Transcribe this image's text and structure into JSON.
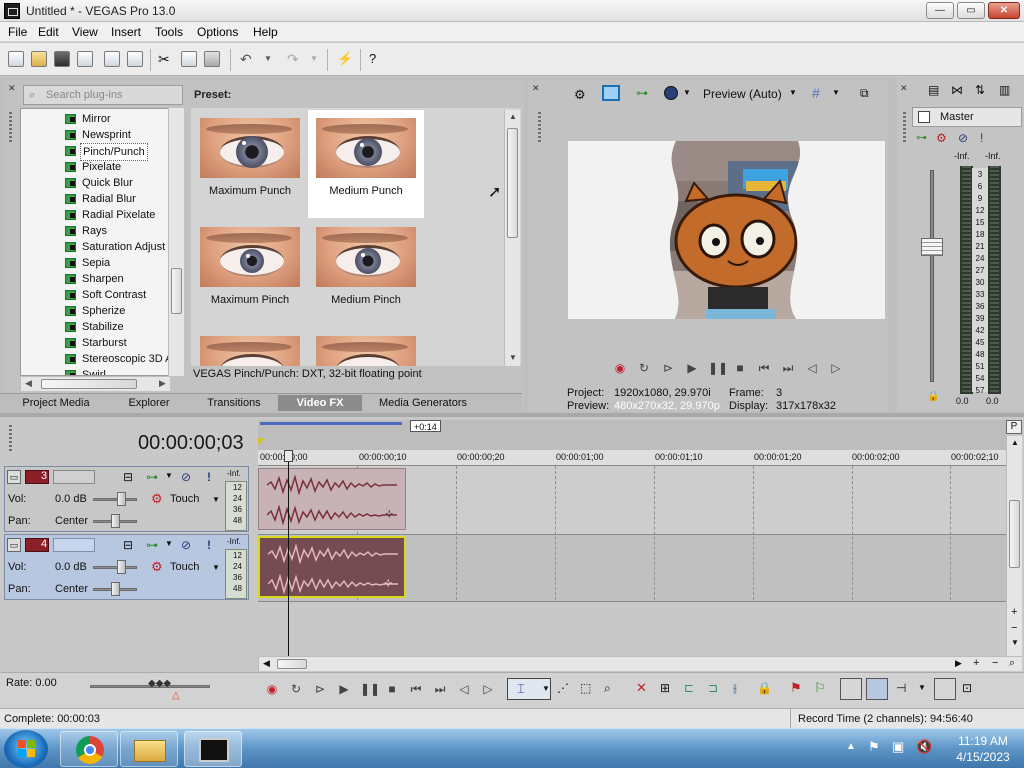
{
  "window": {
    "title": "Untitled * - VEGAS Pro 13.0",
    "controls": {
      "minimize": "—",
      "maximize": "▭",
      "close": "✕"
    }
  },
  "menu": [
    "File",
    "Edit",
    "View",
    "Insert",
    "Tools",
    "Options",
    "Help"
  ],
  "plugins": {
    "search_placeholder": "Search plug-ins",
    "items": [
      "Mirror",
      "Newsprint",
      "Pinch/Punch",
      "Pixelate",
      "Quick Blur",
      "Radial Blur",
      "Radial Pixelate",
      "Rays",
      "Saturation Adjust",
      "Sepia",
      "Sharpen",
      "Soft Contrast",
      "Spherize",
      "Stabilize",
      "Starburst",
      "Stereoscopic 3D A",
      "Swirl"
    ],
    "selected": "Pinch/Punch",
    "icon": "plugin-chip-icon"
  },
  "presets": {
    "label": "Preset:",
    "items": [
      "Maximum Punch",
      "Medium Punch",
      "Maximum Pinch",
      "Medium Pinch",
      "",
      ""
    ],
    "selected": "Medium Punch",
    "description": "VEGAS Pinch/Punch: DXT, 32-bit floating point"
  },
  "tabs": [
    "Project Media",
    "Explorer",
    "Transitions",
    "Video FX",
    "Media Generators"
  ],
  "active_tab": "Video FX",
  "preview": {
    "mode": "Preview (Auto)",
    "project_label": "Project:",
    "project_value": "1920x1080, 29.970i",
    "preview_label": "Preview:",
    "preview_value": "480x270x32, 29.970p",
    "frame_label": "Frame:",
    "frame_value": "3",
    "display_label": "Display:",
    "display_value": "317x178x32"
  },
  "mixer": {
    "title": "Master",
    "peak_left": "-Inf.",
    "peak_right": "-Inf.",
    "scale": [
      "3",
      "6",
      "9",
      "12",
      "15",
      "18",
      "21",
      "24",
      "27",
      "30",
      "33",
      "36",
      "39",
      "42",
      "45",
      "48",
      "51",
      "54",
      "57"
    ],
    "value_left": "0.0",
    "value_right": "0.0"
  },
  "timeline": {
    "timecode": "00:00:00;03",
    "marker_offset": "+0:14",
    "ruler": [
      "00:00:00;00",
      "00:00:00;10",
      "00:00:00;20",
      "00:00:01;00",
      "00:00:01;10",
      "00:00:01;20",
      "00:00:02;00",
      "00:00:02;10"
    ],
    "tracks": [
      {
        "number": "3",
        "vol_label": "Vol:",
        "vol": "0.0 dB",
        "pan_label": "Pan:",
        "pan": "Center",
        "mode": "Touch",
        "peak": "-Inf.",
        "meter": [
          "12",
          "24",
          "36",
          "48"
        ]
      },
      {
        "number": "4",
        "vol_label": "Vol:",
        "vol": "0.0 dB",
        "pan_label": "Pan:",
        "pan": "Center",
        "mode": "Touch",
        "peak": "-Inf.",
        "meter": [
          "12",
          "24",
          "36",
          "48"
        ]
      }
    ],
    "rate": "Rate: 0.00"
  },
  "status": {
    "complete": "Complete: 00:00:03",
    "record_time": "Record Time (2 channels): 94:56:40"
  },
  "taskbar": {
    "time": "11:19 AM",
    "date": "4/15/2023"
  },
  "colors": {
    "selected_track": "#b7c7e0",
    "clip_selected_border": "#d9d91b",
    "clip_audio": "#744c52",
    "record_button": "#d01f2b"
  }
}
